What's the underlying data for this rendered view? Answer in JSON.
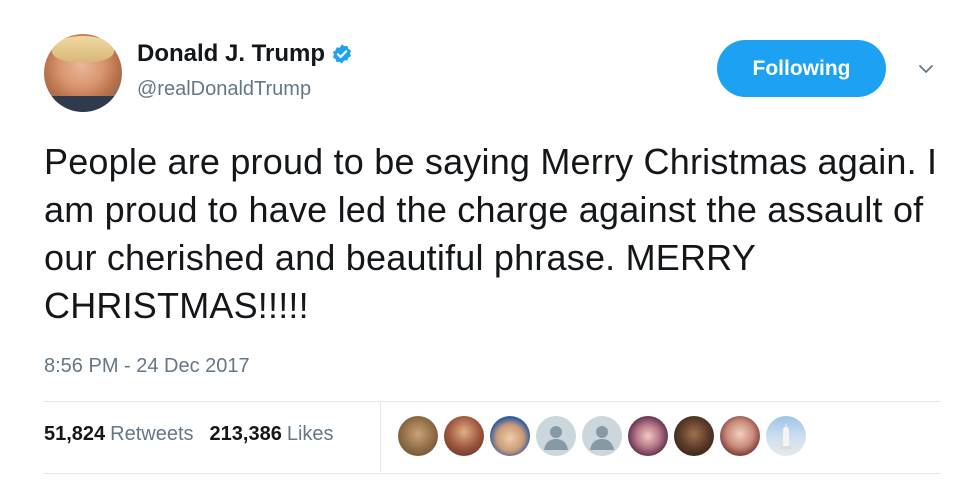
{
  "user": {
    "name": "Donald J. Trump",
    "handle": "@realDonaldTrump",
    "verified": true
  },
  "follow_button": {
    "label": "Following"
  },
  "tweet": {
    "text": "People are proud to be saying Merry Christmas again. I am proud to have led the charge against the assault of our cherished and beautiful phrase. MERRY CHRISTMAS!!!!!",
    "timestamp": "8:56 PM - 24 Dec 2017"
  },
  "stats": {
    "retweets_count": "51,824",
    "retweets_label": "Retweets",
    "likes_count": "213,386",
    "likes_label": "Likes"
  },
  "colors": {
    "accent": "#1da1f2",
    "secondary_text": "#657786",
    "primary_text": "#14171a",
    "divider": "#e1e8ed"
  },
  "icons": [
    "verified-badge-icon",
    "chevron-down-icon",
    "default-avatar-icon"
  ]
}
